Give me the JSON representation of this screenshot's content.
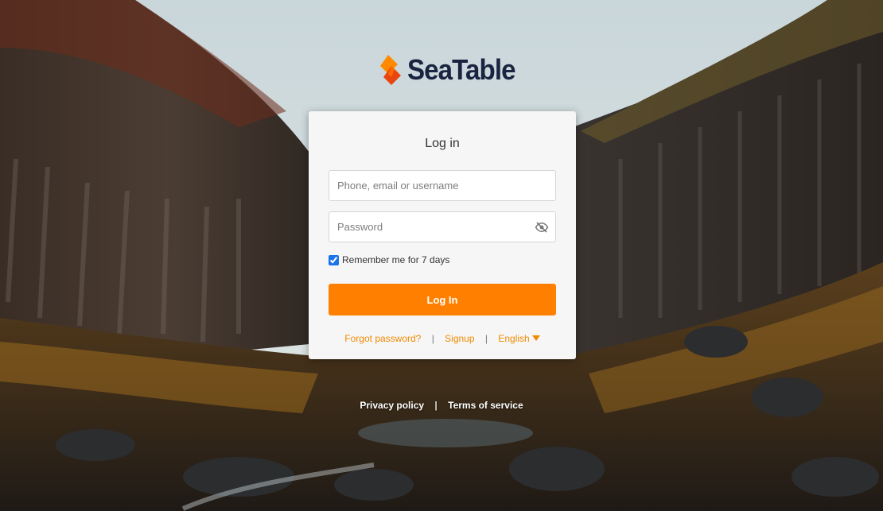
{
  "brand": {
    "name": "SeaTable",
    "accent": "#ff8000",
    "text_color": "#1a2440"
  },
  "login": {
    "title": "Log in",
    "username_placeholder": "Phone, email or username",
    "username_value": "",
    "password_placeholder": "Password",
    "password_value": "",
    "password_toggle_icon": "eye-slash-icon",
    "remember_label": "Remember me for 7 days",
    "remember_checked": true,
    "submit_label": "Log In"
  },
  "links": {
    "forgot": "Forgot password?",
    "signup": "Signup",
    "language": "English",
    "separator": "|",
    "link_color": "#f08a00"
  },
  "footer": {
    "privacy": "Privacy policy",
    "separator": "|",
    "terms": "Terms of service"
  }
}
